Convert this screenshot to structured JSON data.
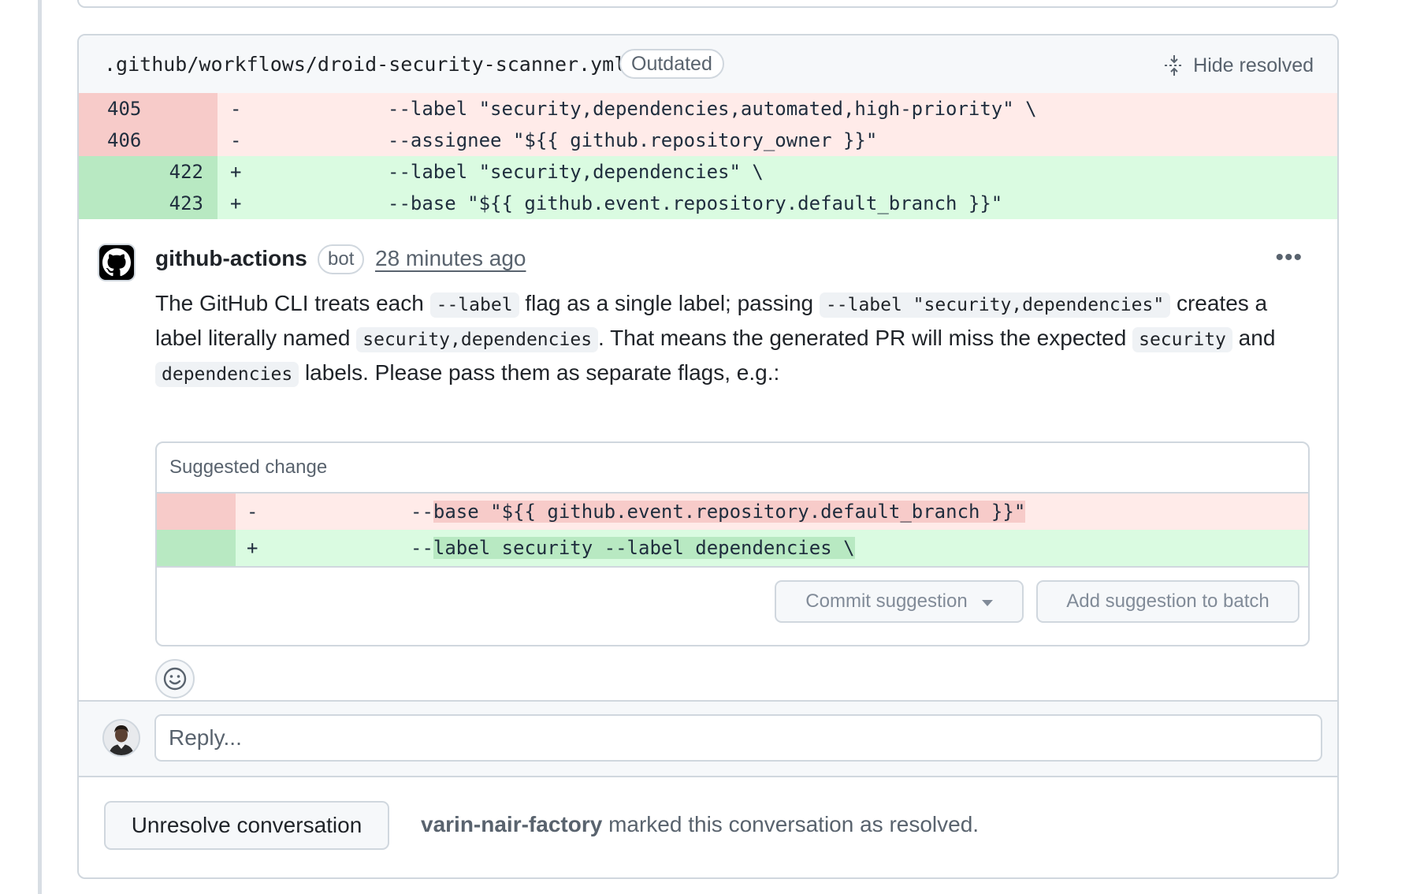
{
  "file": {
    "path": ".github/workflows/droid-security-scanner.yml",
    "status_badge": "Outdated",
    "hide_resolved_label": "Hide resolved"
  },
  "diff": [
    {
      "type": "del",
      "old": "405",
      "new": "",
      "sign": "-",
      "code": "--label \"security,dependencies,automated,high-priority\" \\"
    },
    {
      "type": "del",
      "old": "406",
      "new": "",
      "sign": "-",
      "code": "--assignee \"${{ github.repository_owner }}\""
    },
    {
      "type": "add",
      "old": "",
      "new": "422",
      "sign": "+",
      "code": "--label \"security,dependencies\" \\"
    },
    {
      "type": "add",
      "old": "",
      "new": "423",
      "sign": "+",
      "code": "--base \"${{ github.event.repository.default_branch }}\""
    }
  ],
  "comment": {
    "author": "github-actions",
    "badge": "bot",
    "timestamp": "28 minutes ago",
    "body": {
      "t1": "The GitHub CLI treats each ",
      "c1": "--label",
      "t2": " flag as a single label; passing ",
      "c2": "--label \"security,dependencies\"",
      "t3": " creates a label literally named ",
      "c3": "security,dependencies",
      "t4": ". That means the generated PR will miss the expected ",
      "c4": "security",
      "t5": " and ",
      "c5": "dependencies",
      "t6": " labels. Please pass them as separate flags, e.g.:"
    },
    "suggestion": {
      "title": "Suggested change",
      "del_sign": "-",
      "del_prefix": "--",
      "del_highlight": "base \"${{ github.event.repository.default_branch }}\"",
      "add_sign": "+",
      "add_prefix": "--",
      "add_highlight": "label security --label dependencies \\",
      "commit_label": "Commit suggestion",
      "batch_label": "Add suggestion to batch"
    }
  },
  "reply": {
    "placeholder": "Reply..."
  },
  "resolution": {
    "button_label": "Unresolve conversation",
    "user": "varin-nair-factory",
    "message": " marked this conversation as resolved."
  },
  "colors": {
    "del_gutter": "#f7cbc9",
    "del_line": "#ffebe9",
    "add_gutter": "#b8e9c2",
    "add_line": "#dafbe1",
    "muted_text": "#59636e",
    "border": "#d0d7de"
  },
  "icons": [
    "fold-icon",
    "github-logo-icon",
    "kebab-horizontal-icon",
    "triangle-down-icon",
    "smiley-icon",
    "user-avatar"
  ]
}
